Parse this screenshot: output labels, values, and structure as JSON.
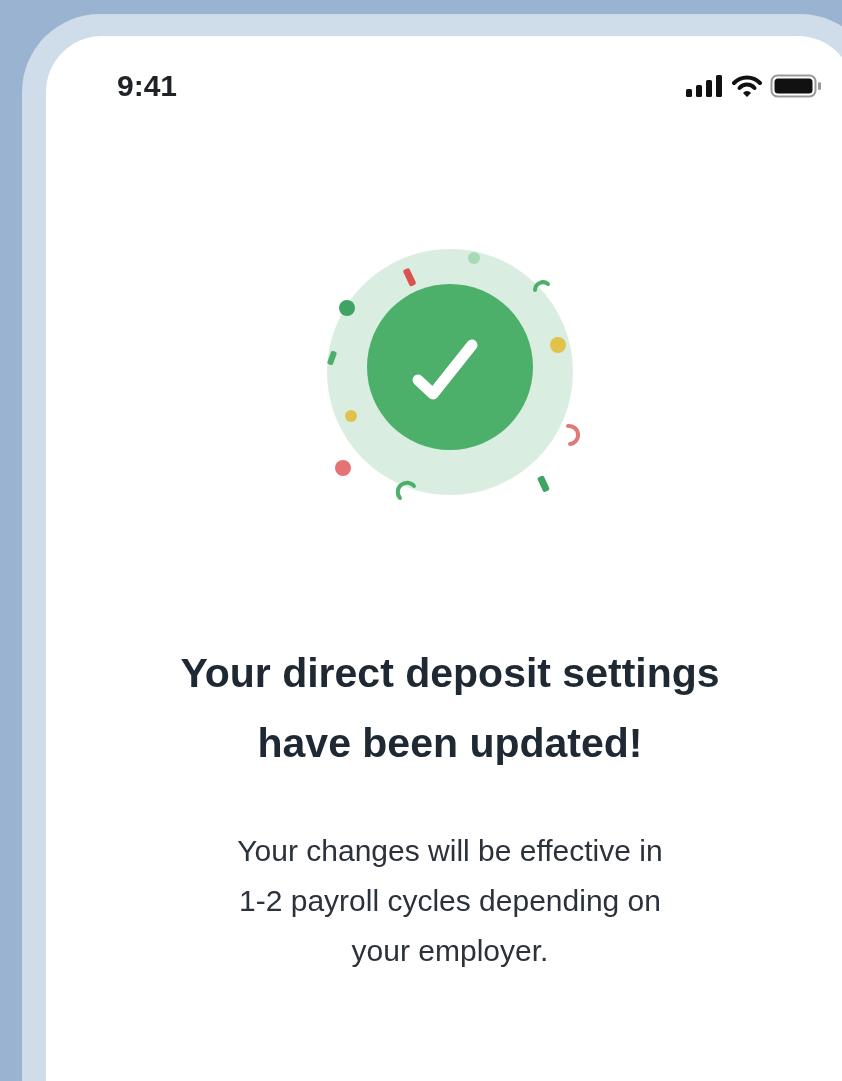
{
  "status_bar": {
    "time": "9:41"
  },
  "title": "Your direct deposit settings\nhave been updated!",
  "message": "Your changes will be effective in\n1-2 payroll cycles depending on\nyour employer."
}
